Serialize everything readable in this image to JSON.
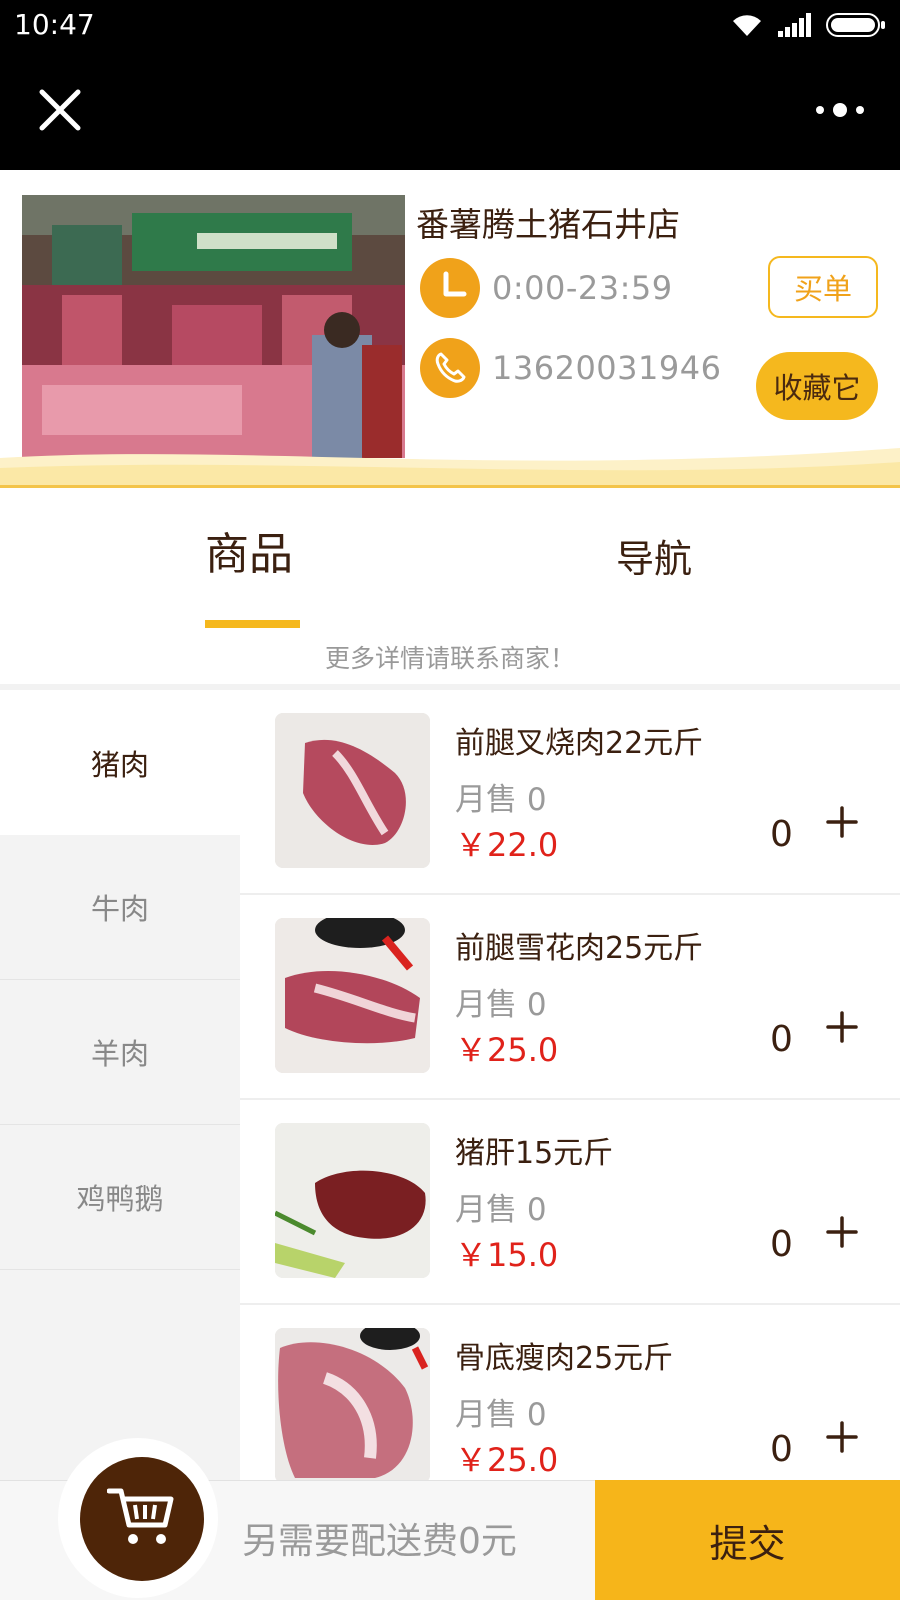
{
  "status_bar": {
    "time": "10:47"
  },
  "store": {
    "name": "番薯腾土猪石井店",
    "hours": "0:00-23:59",
    "phone": "13620031946",
    "pay_label": "买单",
    "favorite_label": "收藏它"
  },
  "tabs": [
    {
      "label": "商品",
      "active": true
    },
    {
      "label": "导航",
      "active": false
    }
  ],
  "notice": "更多详情请联系商家！",
  "categories": [
    {
      "label": "猪肉",
      "active": true
    },
    {
      "label": "牛肉"
    },
    {
      "label": "羊肉"
    },
    {
      "label": "鸡鸭鹅"
    }
  ],
  "products": [
    {
      "name": "前腿叉烧肉22元斤",
      "sold": "月售 0",
      "price": "￥22.0",
      "qty": "0"
    },
    {
      "name": "前腿雪花肉25元斤",
      "sold": "月售 0",
      "price": "￥25.0",
      "qty": "0"
    },
    {
      "name": "猪肝15元斤",
      "sold": "月售 0",
      "price": "￥15.0",
      "qty": "0"
    },
    {
      "name": "骨底瘦肉25元斤",
      "sold": "月售 0",
      "price": "￥25.0",
      "qty": "0"
    }
  ],
  "bottom": {
    "delivery": "另需要配送费0元",
    "submit": "提交"
  },
  "colors": {
    "accent": "#f5b81e",
    "price": "#e0221a",
    "brown": "#4e2508"
  },
  "icons": {
    "close": "close-icon",
    "more": "more-icon",
    "clock": "clock-icon",
    "phone": "phone-icon",
    "plus": "plus-icon",
    "cart": "cart-icon"
  }
}
